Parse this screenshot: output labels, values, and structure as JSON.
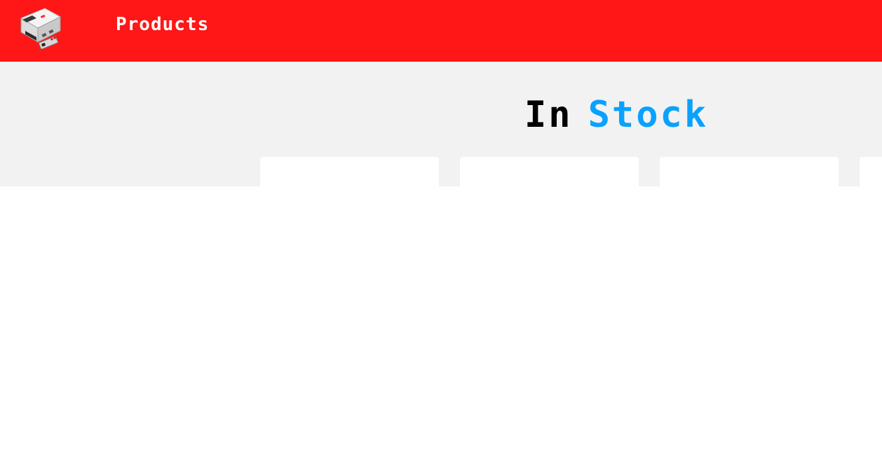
{
  "header": {
    "logo_icon": "nes-console-icon",
    "nav_label": "Products",
    "background_color": "#ff1616"
  },
  "hero": {
    "heading_word_1": "In",
    "heading_word_2": "Stock",
    "accent_color": "#0aa1ff",
    "background_color": "#f2f2f2"
  }
}
